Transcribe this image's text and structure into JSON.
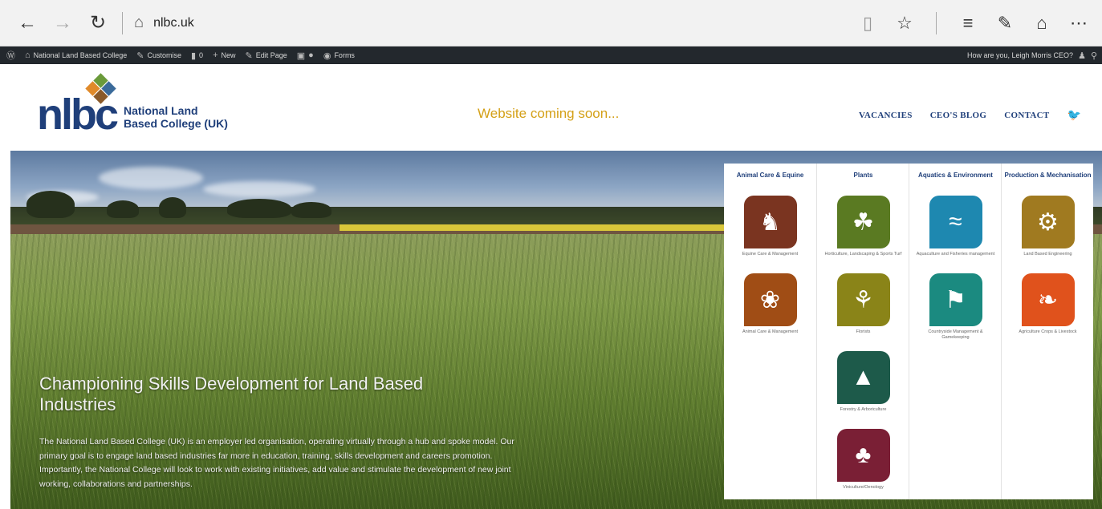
{
  "browser": {
    "url": "nlbc.uk",
    "back_icon": "←",
    "forward_icon": "→",
    "refresh_icon": "↻",
    "lock_icon": "⌂",
    "reading_icon": "▯",
    "favorite_icon": "☆",
    "hub_icon": "≡",
    "note_icon": "✎",
    "share_icon": "⌂",
    "more_icon": "⋯"
  },
  "wp_admin_bar": {
    "wp_logo": "Ⓦ",
    "site_name": "National Land Based College",
    "customise": "Customise",
    "comments": "0",
    "new": "New",
    "edit_page": "Edit Page",
    "forms": "Forms",
    "greeting": "How are you, Leigh Morris CEO?"
  },
  "site": {
    "logo_text": "nlbc",
    "name_line1": "National Land",
    "name_line2": "Based College (UK)",
    "coming_soon": "Website coming soon...",
    "nav": [
      "VACANCIES",
      "CEO'S BLOG",
      "CONTACT"
    ],
    "twitter_icon": "♥"
  },
  "hero": {
    "title": "Championing Skills Development for Land Based Industries",
    "text": "The National Land Based College (UK) is an employer led organisation, operating virtually through a hub and spoke model. Our primary goal is to engage land based industries far more in education, training, skills development and careers promotion. Importantly, the National College will look to work with existing initiatives, add value and stimulate the development of new joint working, collaborations and partnerships."
  },
  "categories": [
    {
      "heading": "Animal Care & Equine",
      "items": [
        {
          "label": "Equine Care & Management",
          "glyph": "♞",
          "color": "#7a3420"
        },
        {
          "label": "Animal Care & Management",
          "glyph": "❀",
          "color": "#a04d15"
        }
      ]
    },
    {
      "heading": "Plants",
      "items": [
        {
          "label": "Horticulture, Landscaping & Sports Turf",
          "glyph": "☘",
          "color": "#5a7a22"
        },
        {
          "label": "Florists",
          "glyph": "⚘",
          "color": "#8a8418"
        },
        {
          "label": "Forestry & Arboriculture",
          "glyph": "▲",
          "color": "#1d5a4a"
        },
        {
          "label": "Viniculture/Oenology",
          "glyph": "♣",
          "color": "#7a1f35"
        }
      ]
    },
    {
      "heading": "Aquatics & Environment",
      "items": [
        {
          "label": "Aquaculture and Fisheries management",
          "glyph": "≈",
          "color": "#1e88b0"
        },
        {
          "label": "Countryside Management & Gamekeeping",
          "glyph": "⚑",
          "color": "#1b8a80"
        }
      ]
    },
    {
      "heading": "Production & Mechanisation",
      "items": [
        {
          "label": "Land Based Engineering",
          "glyph": "⚙",
          "color": "#a07a20"
        },
        {
          "label": "Agriculture Crops & Livestock",
          "glyph": "❧",
          "color": "#e0521c"
        }
      ]
    }
  ]
}
